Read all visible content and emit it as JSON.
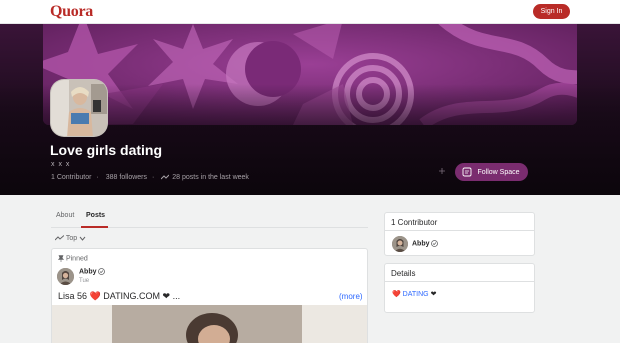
{
  "header": {
    "logo": "Quora",
    "sign_in_label": "Sign In"
  },
  "space": {
    "title": "Love girls dating",
    "subtitle": "x x x",
    "stats": {
      "contributors": "1 Contributor",
      "separator": "·",
      "followers": "388 followers",
      "posts": "28 posts in the last week"
    },
    "follow_label": "Follow Space"
  },
  "tabs": [
    {
      "label": "About",
      "selected": false
    },
    {
      "label": "Posts",
      "selected": true
    }
  ],
  "sort": {
    "label": "Top"
  },
  "post": {
    "pinned_label": "Pinned",
    "author": "Abby",
    "time": "Tue",
    "text": "Lisa 56 ❤️ DATING.COM ❤ ...",
    "more_label": "(more)"
  },
  "sidebar": {
    "contributors_title": "1 Contributor",
    "contributor_name": "Abby",
    "details_title": "Details",
    "details_prefix": "❤️",
    "details_link": "DATING",
    "details_suffix": "❤"
  },
  "colors": {
    "brand": "#b92b27",
    "follow_button": "#7a2c6f",
    "link": "#2e69ff"
  },
  "icons": {
    "trending": "trending-up-icon",
    "pin": "pin-icon",
    "verified": "verified-badge-icon",
    "follow": "follow-space-icon",
    "more": "more-dots-icon",
    "chevron": "chevron-down-icon"
  }
}
